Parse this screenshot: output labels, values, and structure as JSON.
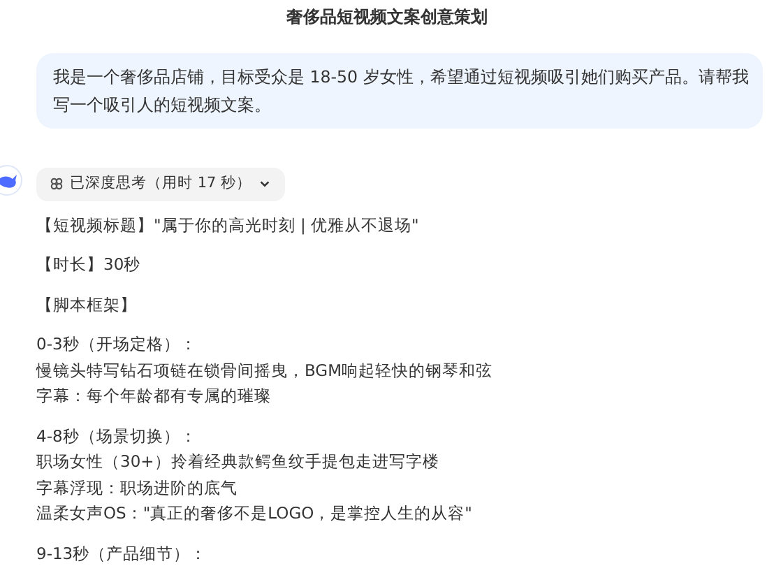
{
  "title": "奢侈品短视频文案创意策划",
  "prompt": "我是一个奢侈品店铺，目标受众是 18-50 岁女性，希望通过短视频吸引她们购买产品。请帮我写一个吸引人的短视频文案。",
  "thinking": {
    "label": "已深度思考（用时 17 秒）",
    "expanded": false
  },
  "paragraphs": [
    {
      "lines": [
        "【短视频标题】\"属于你的高光时刻 | 优雅从不退场\""
      ]
    },
    {
      "lines": [
        "【时长】30秒"
      ]
    },
    {
      "lines": [
        "【脚本框架】"
      ]
    },
    {
      "lines": [
        "0-3秒（开场定格）：",
        "慢镜头特写钻石项链在锁骨间摇曳，BGM响起轻快的钢琴和弦",
        "字幕：每个年龄都有专属的璀璨"
      ]
    },
    {
      "lines": [
        "4-8秒（场景切换）：",
        "职场女性（30+）拎着经典款鳄鱼纹手提包走进写字楼",
        "字幕浮现：职场进阶的底气",
        "温柔女声OS：\"真正的奢侈不是LOGO，是掌控人生的从容\""
      ]
    },
    {
      "lines": [
        "9-13秒（产品细节）："
      ]
    }
  ]
}
